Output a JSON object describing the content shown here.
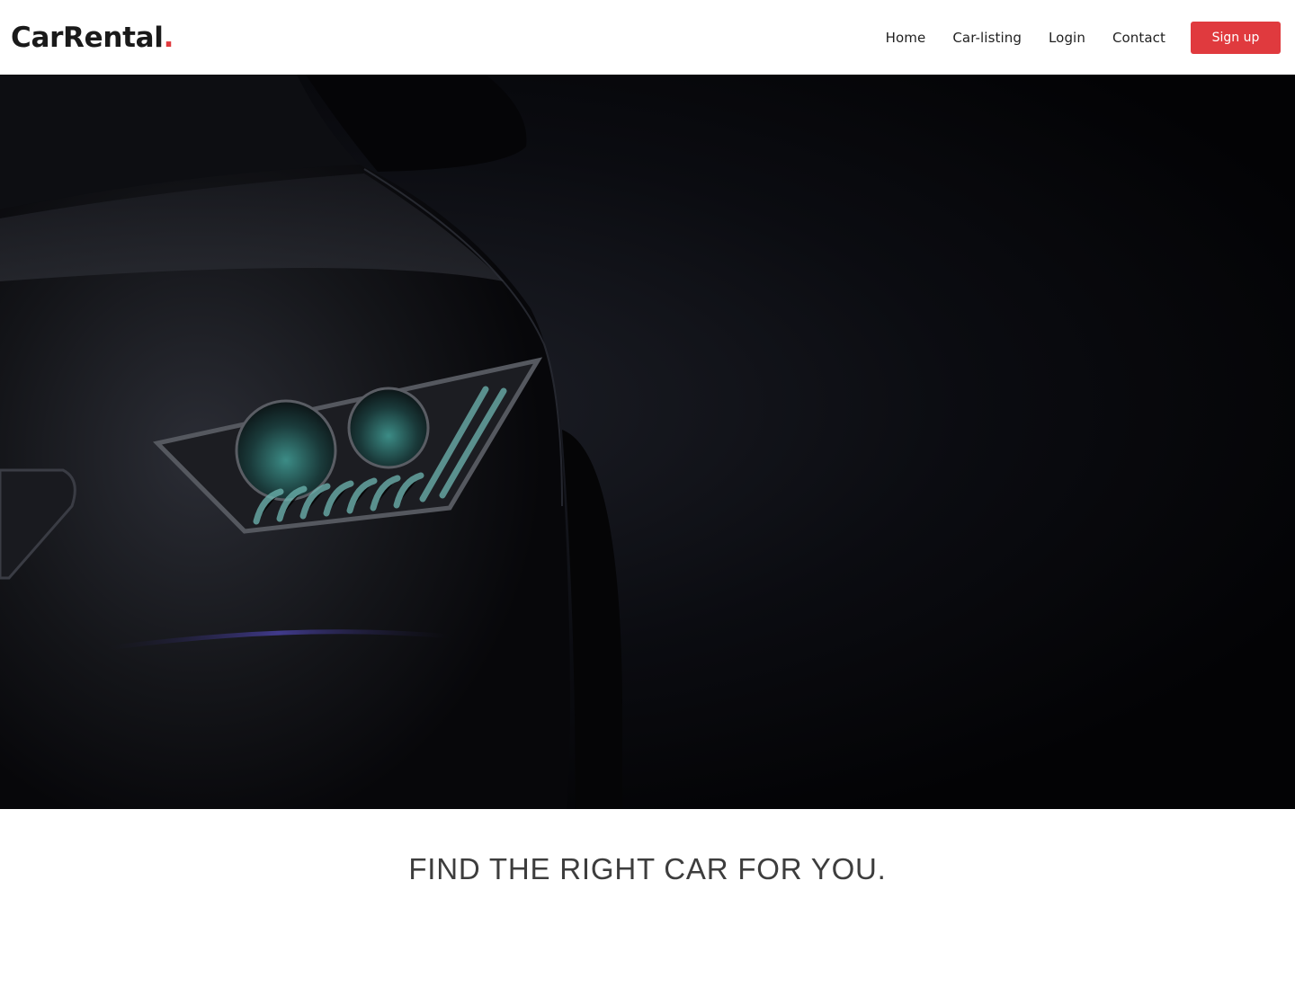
{
  "navbar": {
    "brand": "CarRental",
    "brand_dot": ".",
    "links": [
      {
        "label": "Home"
      },
      {
        "label": "Car-listing"
      },
      {
        "label": "Login"
      },
      {
        "label": "Contact"
      }
    ],
    "signup_label": "Sign up"
  },
  "hero": {
    "image": "car-headlight-dark"
  },
  "tagline": {
    "text": "FIND THE RIGHT CAR FOR YOU."
  },
  "colors": {
    "accent": "#e03a3e",
    "text_dark": "#1a1a1a",
    "tagline": "#3d3d3d"
  }
}
